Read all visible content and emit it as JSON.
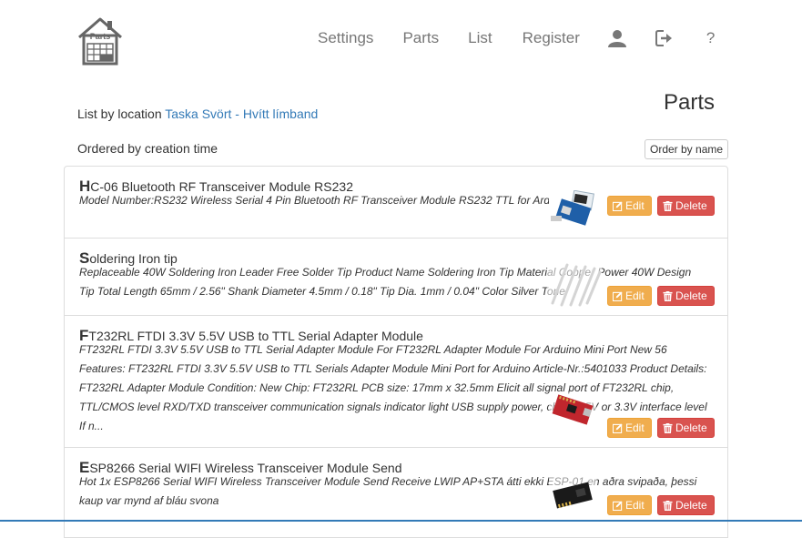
{
  "header": {
    "logo_text": "Parts",
    "nav": {
      "settings": "Settings",
      "parts": "Parts",
      "list": "List",
      "register": "Register",
      "help": "?"
    },
    "icons": {
      "user": "user-icon",
      "logout": "logout-icon"
    }
  },
  "page": {
    "title": "Parts",
    "location_prefix": "List by location",
    "location_link": "Taska Svört - Hvítt límband",
    "ordered_text": "Ordered by creation time",
    "order_button": "Order by name"
  },
  "buttons": {
    "edit": "Edit",
    "delete": "Delete"
  },
  "colors": {
    "link": "#337ab7",
    "edit": "#f0ad4e",
    "delete": "#d9534f"
  },
  "parts": [
    {
      "initial": "H",
      "name_rest": "C-06 Bluetooth RF Transceiver Module RS232",
      "description": "Model Number:RS232 Wireless Serial 4 Pin Bluetooth RF Transceiver Module RS232 TTL for Arduino"
    },
    {
      "initial": "S",
      "name_rest": "oldering Iron tip",
      "description": "Replaceable 40W Soldering Iron Leader Free Solder Tip Product Name Soldering Iron Tip Material Copper Power 40W Design Tip Total Length 65mm / 2.56\" Shank Diameter 4.5mm / 0.18\" Tip Dia. 1mm / 0.04\" Color Silver Tone"
    },
    {
      "initial": "F",
      "name_rest": "T232RL FTDI 3.3V 5.5V USB to TTL Serial Adapter Module",
      "description": "FT232RL FTDI 3.3V 5.5V USB to TTL Serial Adapter Module For FT232RL Adapter Module For Arduino Mini Port New 56 Features: FT232RL FTDI 3.3V 5.5V USB to TTL Serials Adapter Module Mini Port for Arduino Article-Nr.:5401033 Product Details: FT232RL Adapter Module Condition: New Chip: FT232RL PCB size: 17mm x 32.5mm Elicit all signal port of FT232RL chip, TTL/CMOS level RXD/TXD transceiver communication signals indicator light USB supply power, choose 5V or 3.3V interface level If n..."
    },
    {
      "initial": "E",
      "name_rest": "SP8266 Serial WIFI Wireless Transceiver Module Send",
      "description": "Hot 1x ESP8266 Serial WIFI Wireless Transceiver Module Send Receive LWIP AP+STA átti ekki ESP-01 en aðra svipaða, þessi kaup var mynd af bláu svona"
    }
  ]
}
